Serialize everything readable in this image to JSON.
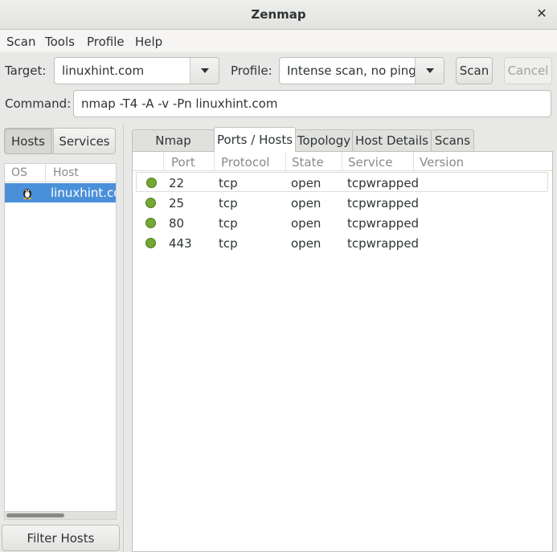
{
  "window": {
    "title": "Zenmap"
  },
  "menu": [
    "Scan",
    "Tools",
    "Profile",
    "Help"
  ],
  "toolbar": {
    "target_label": "Target:",
    "target_value": "linuxhint.com",
    "profile_label": "Profile:",
    "profile_value": "Intense scan, no ping",
    "scan_button": "Scan",
    "cancel_button": "Cancel",
    "command_label": "Command:",
    "command_value": "nmap -T4 -A -v -Pn linuxhint.com"
  },
  "left_pane": {
    "hosts_button": "Hosts",
    "services_button": "Services",
    "columns": {
      "os": "OS",
      "host": "Host"
    },
    "hosts": [
      {
        "name": "linuxhint.com",
        "os_icon": "linux-penguin-icon"
      }
    ],
    "filter_button": "Filter Hosts"
  },
  "tabs": [
    "Nmap Output",
    "Ports / Hosts",
    "Topology",
    "Host Details",
    "Scans"
  ],
  "active_tab": "Ports / Hosts",
  "ports_table": {
    "columns": {
      "port": "Port",
      "protocol": "Protocol",
      "state": "State",
      "service": "Service",
      "version": "Version"
    },
    "rows": [
      {
        "port": "22",
        "protocol": "tcp",
        "state": "open",
        "service": "tcpwrapped",
        "version": ""
      },
      {
        "port": "25",
        "protocol": "tcp",
        "state": "open",
        "service": "tcpwrapped",
        "version": ""
      },
      {
        "port": "80",
        "protocol": "tcp",
        "state": "open",
        "service": "tcpwrapped",
        "version": ""
      },
      {
        "port": "443",
        "protocol": "tcp",
        "state": "open",
        "service": "tcpwrapped",
        "version": ""
      }
    ],
    "status_color": "#73a833"
  },
  "colors": {
    "selection": "#4a90d9"
  }
}
